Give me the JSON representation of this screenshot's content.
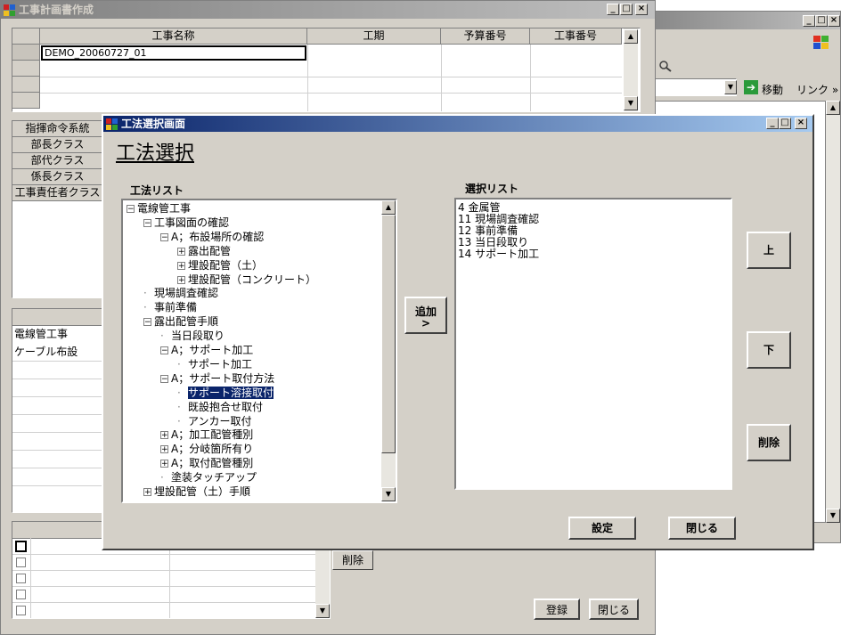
{
  "bg_window": {
    "buttons": [
      "_",
      "□",
      "×"
    ],
    "toolbar": {
      "go_label": "移動",
      "link_label": "リンク »"
    }
  },
  "main_window": {
    "title": "工事計画書作成",
    "grid": {
      "columns": [
        "工事名称",
        "工期",
        "予算番号",
        "工事番号"
      ],
      "rows": [
        [
          "DEMO_20060727_01",
          "",
          "",
          ""
        ]
      ]
    },
    "class_list": [
      "指揮命令系統",
      "部長クラス",
      "部代クラス",
      "係長クラス",
      "工事責任者クラス"
    ],
    "work_list": [
      "電線管工事",
      "ケーブル布設"
    ],
    "delete_label": "削除",
    "register_label": "登録",
    "close_label": "閉じる"
  },
  "dialog": {
    "title": "工法選択画面",
    "heading": "工法選択",
    "method_list_label": "工法リスト",
    "selection_list_label": "選択リスト",
    "tree": [
      {
        "label": "電線管工事",
        "level": 0,
        "expander": "minus"
      },
      {
        "label": "工事図面の確認",
        "level": 1,
        "expander": "minus"
      },
      {
        "label": "A；布設場所の確認",
        "level": 2,
        "expander": "minus"
      },
      {
        "label": "露出配管",
        "level": 3,
        "expander": "plus"
      },
      {
        "label": "埋設配管（土）",
        "level": 3,
        "expander": "plus"
      },
      {
        "label": "埋設配管（コンクリート）",
        "level": 3,
        "expander": "plus"
      },
      {
        "label": "現場調査確認",
        "level": 1,
        "expander": "none"
      },
      {
        "label": "事前準備",
        "level": 1,
        "expander": "none"
      },
      {
        "label": "露出配管手順",
        "level": 1,
        "expander": "minus"
      },
      {
        "label": "当日段取り",
        "level": 2,
        "expander": "none"
      },
      {
        "label": "A；サポート加工",
        "level": 2,
        "expander": "minus"
      },
      {
        "label": "サポート加工",
        "level": 3,
        "expander": "none"
      },
      {
        "label": "A；サポート取付方法",
        "level": 2,
        "expander": "minus"
      },
      {
        "label": "サポート溶接取付",
        "level": 3,
        "expander": "none",
        "selected": true
      },
      {
        "label": "既設抱合せ取付",
        "level": 3,
        "expander": "none"
      },
      {
        "label": "アンカー取付",
        "level": 3,
        "expander": "none"
      },
      {
        "label": "A；加工配管種別",
        "level": 2,
        "expander": "plus"
      },
      {
        "label": "A；分岐箇所有り",
        "level": 2,
        "expander": "plus"
      },
      {
        "label": "A；取付配管種別",
        "level": 2,
        "expander": "plus"
      },
      {
        "label": "塗装タッチアップ",
        "level": 2,
        "expander": "none"
      },
      {
        "label": "埋設配管（土）手順",
        "level": 1,
        "expander": "plus"
      }
    ],
    "selection_list": [
      "4 金属管",
      "11 現場調査確認",
      "12 事前準備",
      "13 当日段取り",
      "14 サポート加工"
    ],
    "add_label_1": "追加",
    "add_label_2": ">",
    "up_label": "上",
    "down_label": "下",
    "delete_label": "削除",
    "ok_label": "設定",
    "close_label": "閉じる",
    "cap_buttons": [
      "_",
      "□",
      "×"
    ]
  }
}
